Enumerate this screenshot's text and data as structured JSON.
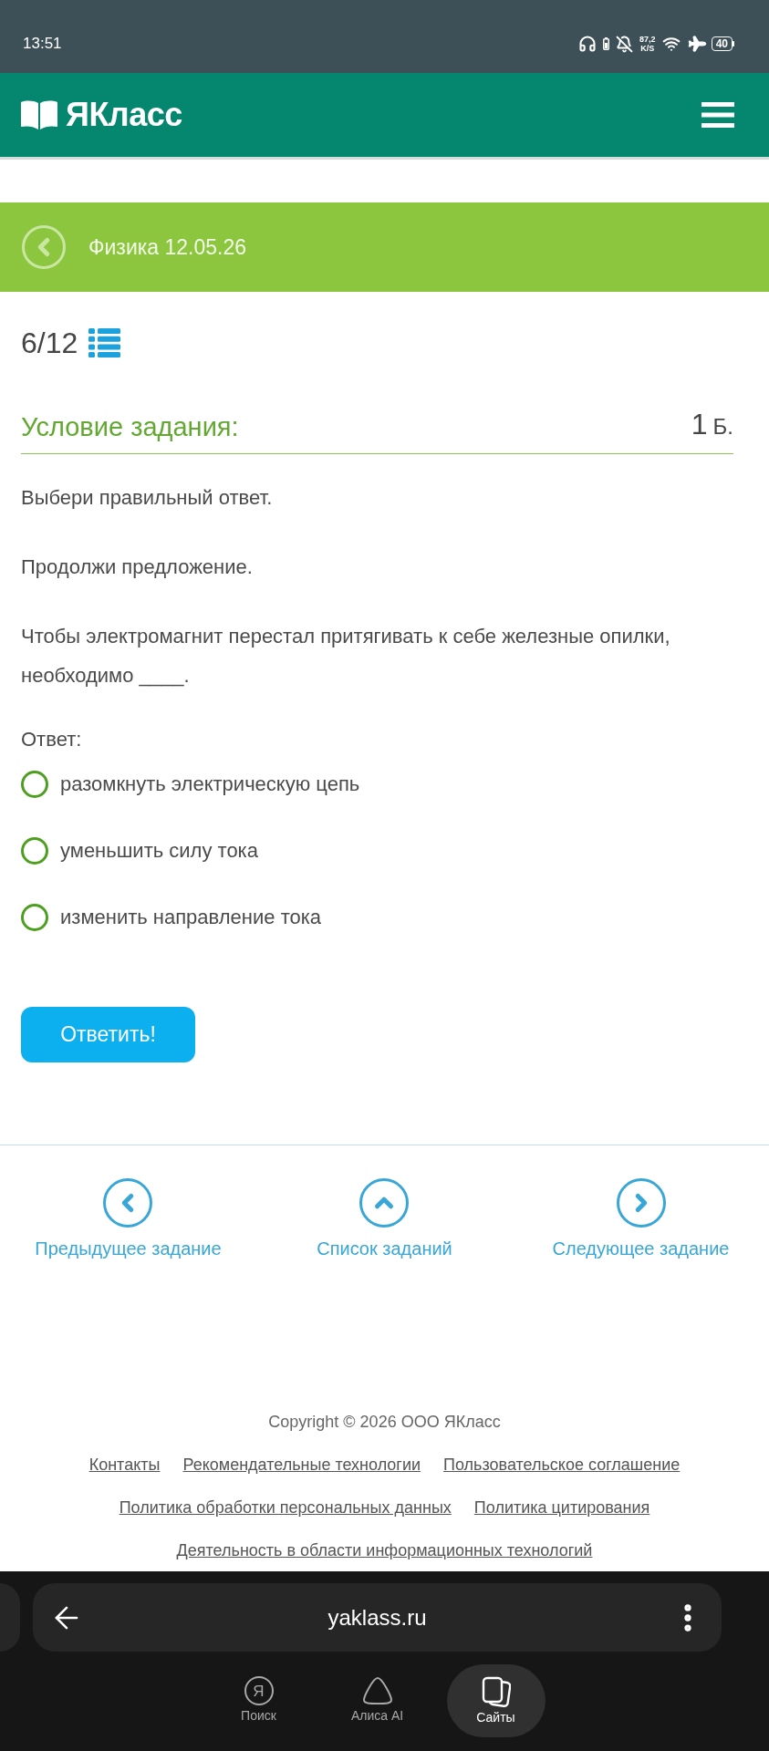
{
  "status_bar": {
    "time": "13:51",
    "network_speed": "87,2",
    "network_speed_unit": "K/S",
    "battery": "40"
  },
  "site_header": {
    "logo": "ЯКласс"
  },
  "title_bar": {
    "title": "Физика 12.05.26"
  },
  "task": {
    "counter": "6/12",
    "condition_title": "Условие задания:",
    "points_value": "1",
    "points_unit": "Б.",
    "paragraphs": [
      "Выбери правильный ответ.",
      "Продолжи предложение.",
      "Чтобы электромагнит перестал притягивать к себе железные опилки, необходимо ____."
    ],
    "answer_label": "Ответ:",
    "options": [
      {
        "label": "разомкнуть электрическую цепь",
        "selected": false
      },
      {
        "label": "уменьшить силу тока",
        "selected": false
      },
      {
        "label": "изменить направление тока",
        "selected": false
      }
    ],
    "submit_button": "Ответить!"
  },
  "task_nav": [
    {
      "kind": "previous",
      "label": "Предыдущее задание"
    },
    {
      "kind": "list",
      "label": "Список заданий"
    },
    {
      "kind": "next",
      "label": "Следующее задание"
    }
  ],
  "footer": {
    "copyright": "Copyright © 2026 ООО ЯКласс",
    "link_rows": [
      [
        "Контакты",
        "Рекомендательные технологии",
        "Пользовательское соглашение"
      ],
      [
        "Политика обработки персональных данных",
        "Политика цитирования"
      ],
      [
        "Деятельность в области информационных технологий"
      ]
    ]
  },
  "browser": {
    "url": "yaklass.ru",
    "tabs": [
      {
        "kind": "search",
        "icon_letter": "Я",
        "label": "Поиск",
        "selected": false
      },
      {
        "kind": "assistant",
        "label": "Алиса AI",
        "selected": false
      },
      {
        "kind": "sites",
        "label": "Сайты",
        "selected": true
      }
    ]
  }
}
